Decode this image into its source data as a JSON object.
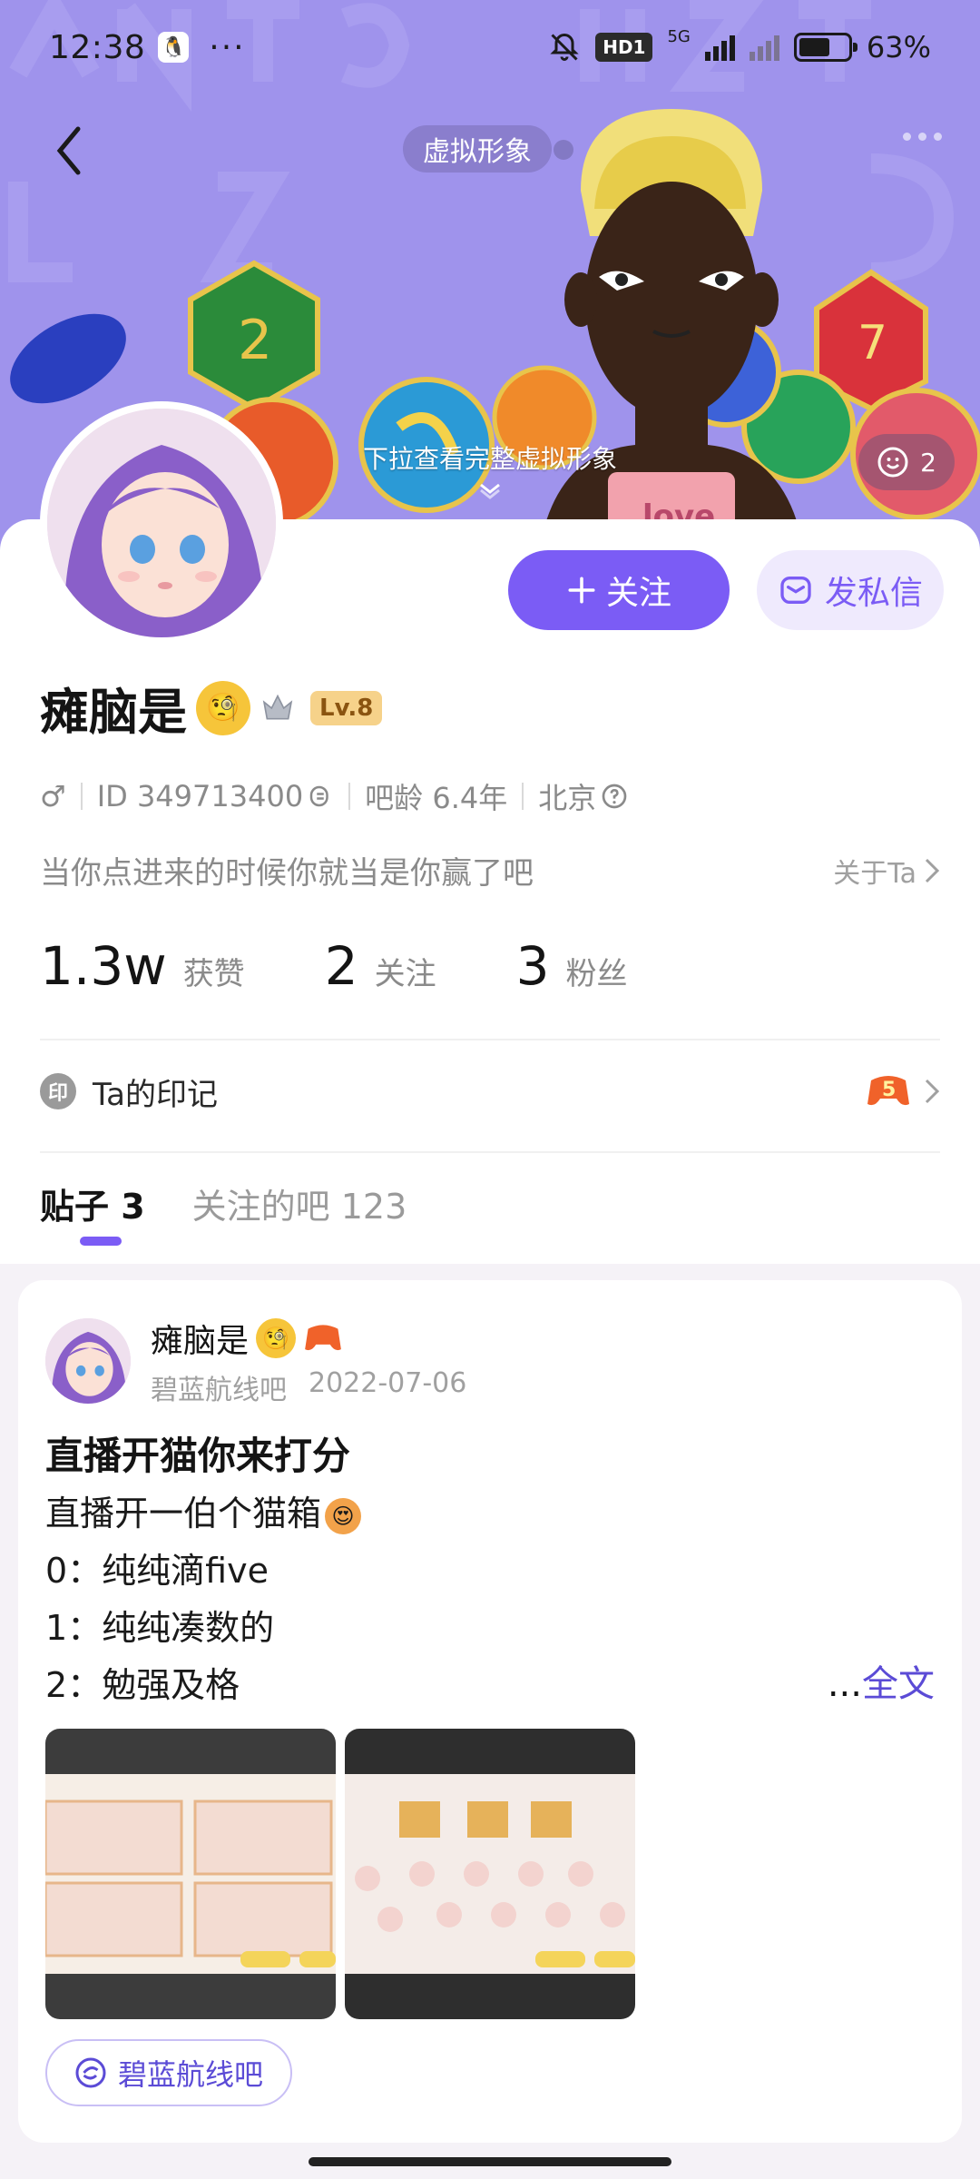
{
  "status_bar": {
    "time": "12:38",
    "more": "···",
    "network_badge": "HD1",
    "network_type": "5G",
    "battery_percent": "63%",
    "battery_level": 0.63
  },
  "header": {
    "avatar_pill_label": "虚拟形象",
    "pull_hint": "下拉查看完整虚拟形象",
    "like_count": "2",
    "character_shirt_text": "love"
  },
  "profile": {
    "follow_label": "关注",
    "dm_label": "发私信",
    "name": "瘫脑是",
    "level": "Lv.8",
    "gender_symbol": "♂",
    "id_text": "ID 349713400",
    "bar_age": "吧龄 6.4年",
    "location": "北京",
    "bio": "当你点进来的时候你就当是你赢了吧",
    "about_label": "关于Ta",
    "stats": [
      {
        "num": "1.3w",
        "label": "获赞"
      },
      {
        "num": "2",
        "label": "关注"
      },
      {
        "num": "3",
        "label": "粉丝"
      }
    ],
    "mark_icon_text": "印",
    "mark_label": "Ta的印记",
    "mark_badge_num": "5"
  },
  "tabs": [
    {
      "label": "贴子 3",
      "active": true
    },
    {
      "label": "关注的吧 123",
      "active": false
    }
  ],
  "post": {
    "author": "瘫脑是",
    "forum": "碧蓝航线吧",
    "date": "2022-07-06",
    "title": "直播开猫你来打分",
    "lines": [
      "直播开一伯个猫箱",
      "0：纯纯滴five",
      "1：纯纯凑数的",
      "2：勉强及格"
    ],
    "ellipsis": "...",
    "full_text_label": "全文",
    "forum_chip": "碧蓝航线吧"
  },
  "colors": {
    "accent": "#7b5cf5",
    "banner": "#9f93ec"
  }
}
